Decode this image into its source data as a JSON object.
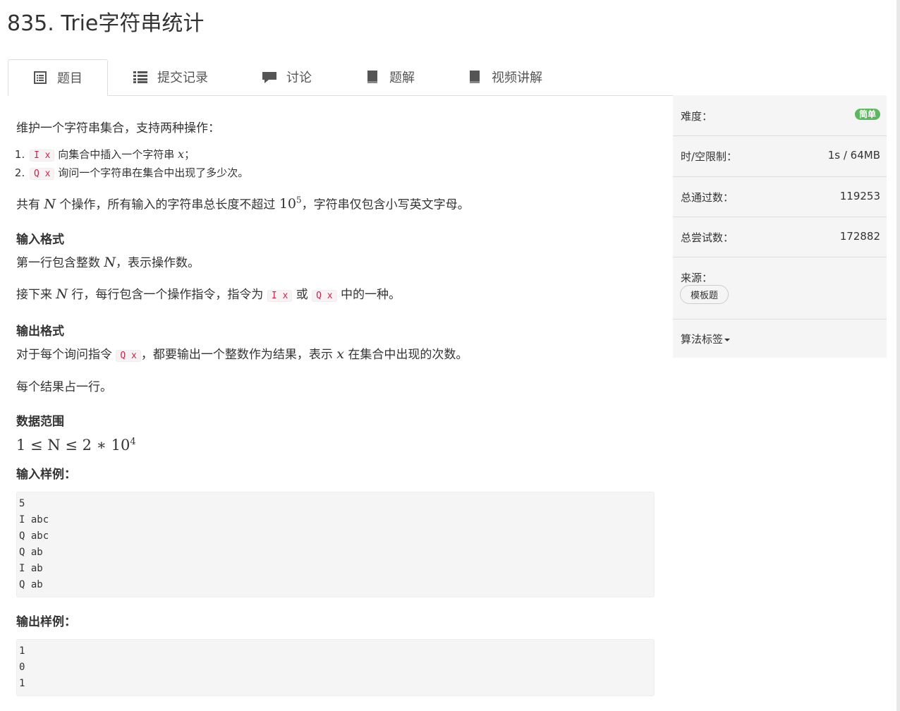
{
  "page_title": "835. Trie字符串统计",
  "tabs": [
    {
      "label": "题目",
      "icon": "list-alt-icon",
      "active": true
    },
    {
      "label": "提交记录",
      "icon": "list-icon"
    },
    {
      "label": "讨论",
      "icon": "comment-icon"
    },
    {
      "label": "题解",
      "icon": "book-icon"
    },
    {
      "label": "视频讲解",
      "icon": "book-icon"
    }
  ],
  "problem": {
    "intro": "维护一个字符串集合，支持两种操作：",
    "ops": [
      {
        "code": "I x",
        "text_before": "向集合中插入一个字符串 ",
        "math": "x",
        "text_after": "；"
      },
      {
        "code": "Q x",
        "text_before": "询问一个字符串在集合中出现了多少次。",
        "math": "",
        "text_after": ""
      }
    ],
    "constraint_pre": "共有 ",
    "constraint_N": "N",
    "constraint_mid": " 个操作，所有输入的字符串总长度不超过 ",
    "constraint_base": "10",
    "constraint_exp": "5",
    "constraint_post": "，字符串仅包含小写英文字母。",
    "input_format_title": "输入格式",
    "input_line1_pre": "第一行包含整数 ",
    "input_line1_math": "N",
    "input_line1_post": "，表示操作数。",
    "input_line2_pre": "接下来 ",
    "input_line2_math": "N",
    "input_line2_mid": " 行，每行包含一个操作指令，指令为 ",
    "input_line2_code1": "I x",
    "input_line2_or": " 或 ",
    "input_line2_code2": "Q x",
    "input_line2_post": " 中的一种。",
    "output_format_title": "输出格式",
    "output_line1_pre": "对于每个询问指令 ",
    "output_line1_code": "Q x",
    "output_line1_mid": "，都要输出一个整数作为结果，表示 ",
    "output_line1_math": "x",
    "output_line1_post": " 在集合中出现的次数。",
    "output_line2": "每个结果占一行。",
    "range_title": "数据范围",
    "range_text": "1 ≤ N ≤ 2 ∗ 10",
    "range_exp": "4",
    "sample_input_title": "输入样例：",
    "sample_input": "5\nI abc\nQ abc\nQ ab\nI ab\nQ ab",
    "sample_output_title": "输出样例：",
    "sample_output": "1\n0\n1"
  },
  "sidebar": {
    "difficulty_label": "难度：",
    "difficulty_value": "简单",
    "limit_label": "时/空限制：",
    "limit_value": "1s / 64MB",
    "passed_label": "总通过数：",
    "passed_value": "119253",
    "tried_label": "总尝试数：",
    "tried_value": "172882",
    "source_label": "来源：",
    "source_tag": "模板题",
    "tags_label": "算法标签"
  },
  "colors": {
    "easy_badge": "#5cb85c",
    "code_text": "#c7254e",
    "code_bg": "#f9f2f4"
  }
}
